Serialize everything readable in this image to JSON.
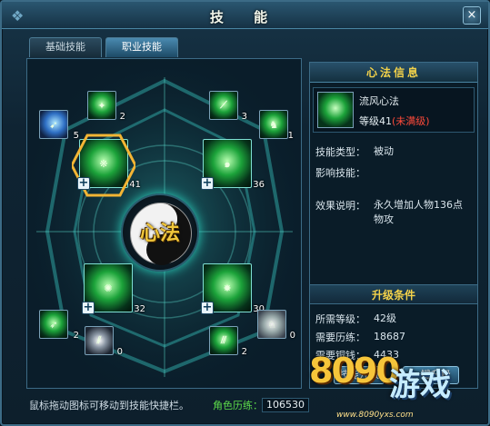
{
  "window": {
    "title": "技 能",
    "close_label": "×"
  },
  "tabs": [
    {
      "label": "基础技能",
      "active": false
    },
    {
      "label": "职业技能",
      "active": true
    }
  ],
  "emblem": {
    "text": "心法"
  },
  "skills": [
    {
      "name": "spear-thrust",
      "icon": "spear-icon",
      "level": "5"
    },
    {
      "name": "blade-burst",
      "icon": "green-blade-icon",
      "level": "2"
    },
    {
      "name": "sword-strike",
      "icon": "sword-slash-icon",
      "level": "3"
    },
    {
      "name": "warrior-stance",
      "icon": "warrior-icon",
      "level": "1"
    },
    {
      "name": "liufeng-xinfa",
      "icon": "green-wind-icon",
      "level": "41",
      "selected": true
    },
    {
      "name": "wind-vortex",
      "icon": "green-swirl-icon",
      "level": "36"
    },
    {
      "name": "spiral-aura",
      "icon": "green-spiral-icon",
      "level": "32"
    },
    {
      "name": "burst-light",
      "icon": "green-burst-icon",
      "level": "30"
    },
    {
      "name": "arrow-thrust",
      "icon": "arrow-icon",
      "level": "2"
    },
    {
      "name": "claw-strike",
      "icon": "claw-icon",
      "level": "0"
    },
    {
      "name": "triple-spear",
      "icon": "triple-spear-icon",
      "level": "2"
    },
    {
      "name": "horse-charge",
      "icon": "horse-icon",
      "level": "0"
    }
  ],
  "info": {
    "header": "心法信息",
    "skill_name": "流风心法",
    "level_prefix": "等级41",
    "level_status": "(未满级)",
    "type_label": "技能类型：",
    "type_value": "被动",
    "affect_label": "影响技能：",
    "affect_value": "",
    "effect_label": "效果说明：",
    "effect_value": "永久增加人物136点物攻",
    "upgrade_title": "升级条件",
    "req_level_label": "所需等级：",
    "req_level_value": "42级",
    "req_exp_label": "需要历练：",
    "req_exp_value": "18687",
    "req_coin_label": "需要铜钱：",
    "req_coin_value": "4433",
    "upgrade_button": "技能升级",
    "oneclick_button": "一键升级"
  },
  "footer": {
    "hint": "鼠标拖动图标可移动到技能快捷栏。",
    "exp_label": "角色历练：",
    "exp_value": "106530"
  },
  "watermark": {
    "brand": "8090",
    "game": "游戏",
    "url": "www.8090yxs.com"
  },
  "colors": {
    "gold": "#f3d24a",
    "unfull": "#ff4a3a",
    "exp_green": "#5ddc4a",
    "frame": "#3c6b86"
  }
}
